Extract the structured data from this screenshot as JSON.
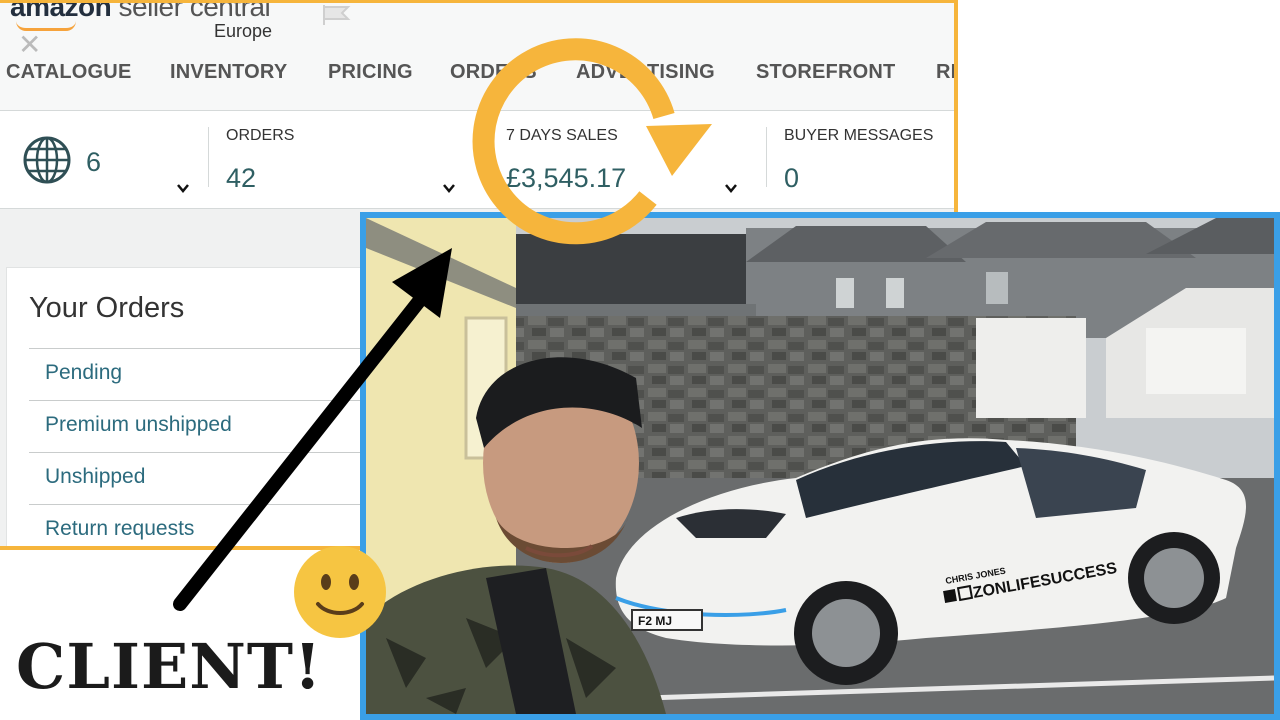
{
  "header": {
    "brand_main": "amazon",
    "brand_rest": " seller central",
    "brand_sub": "Europe",
    "close_glyph": "✕"
  },
  "nav": {
    "items": [
      "CATALOGUE",
      "INVENTORY",
      "PRICING",
      "ORDERS",
      "ADVERTISING",
      "STOREFRONT",
      "RE"
    ]
  },
  "stats": {
    "marketplaces": {
      "icon": "globe-icon",
      "value": "6"
    },
    "orders": {
      "label": "ORDERS",
      "value": "42"
    },
    "sales": {
      "label": "7 DAYS SALES",
      "value": "£3,545.17"
    },
    "messages": {
      "label": "BUYER MESSAGES",
      "value": "0"
    }
  },
  "orders_card": {
    "title": "Your Orders",
    "links": [
      "Pending",
      "Premium unshipped",
      "Unshipped",
      "Return requests"
    ]
  },
  "photo": {
    "car_decal_top": "CHRIS JONES",
    "car_decal_main": "ZONLIFESUCCESS",
    "plate_text": "F2 MJ"
  },
  "overlay": {
    "caption": "CLIENT!",
    "colors": {
      "highlight_border": "#f6b53c",
      "photo_border": "#3a9fe7",
      "arrow": "#000000",
      "refresh_arrow": "#f6b53c"
    }
  }
}
